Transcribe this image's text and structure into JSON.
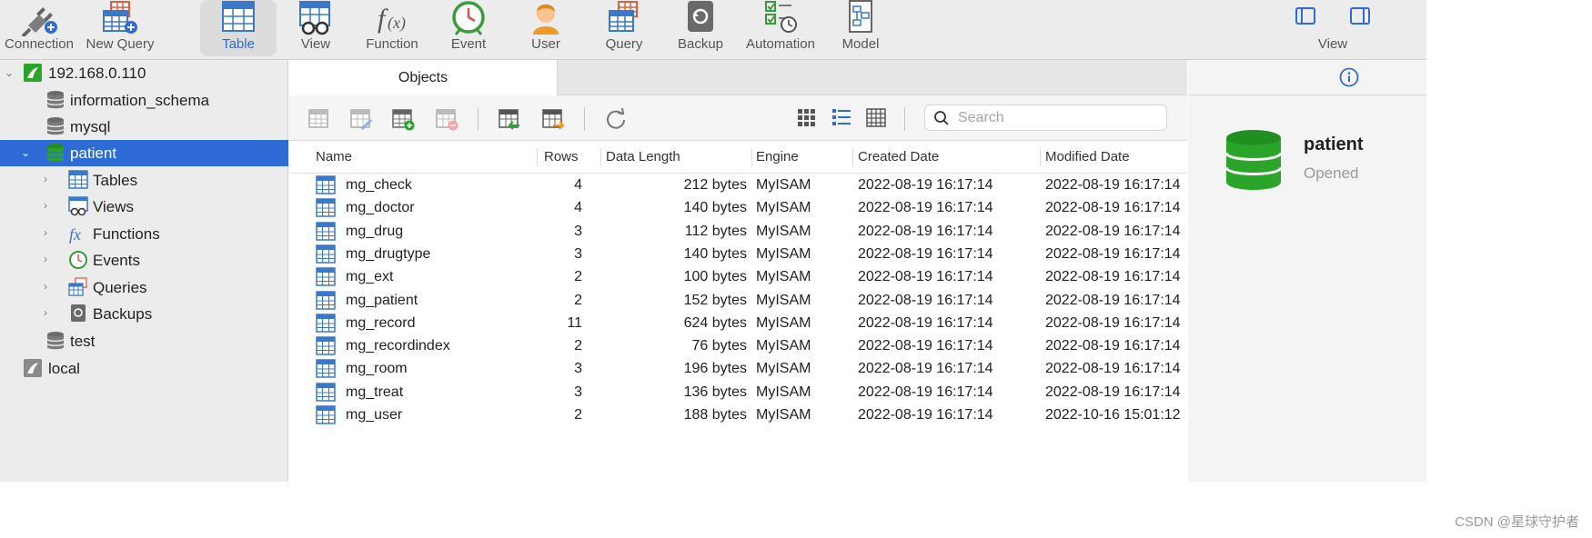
{
  "toolbar": {
    "items": [
      {
        "label": "Connection",
        "icon": "connection-plug-icon"
      },
      {
        "label": "New Query",
        "icon": "new-query-icon"
      },
      {
        "label": "Table",
        "icon": "table-icon",
        "active": true
      },
      {
        "label": "View",
        "icon": "view-glasses-icon"
      },
      {
        "label": "Function",
        "icon": "function-fx-icon"
      },
      {
        "label": "Event",
        "icon": "event-clock-icon"
      },
      {
        "label": "User",
        "icon": "user-icon"
      },
      {
        "label": "Query",
        "icon": "query-icon"
      },
      {
        "label": "Backup",
        "icon": "backup-icon"
      },
      {
        "label": "Automation",
        "icon": "automation-icon"
      },
      {
        "label": "Model",
        "icon": "model-icon"
      }
    ],
    "view_label": "View"
  },
  "sidebar": {
    "connection": "192.168.0.110",
    "databases": [
      "information_schema",
      "mysql",
      "patient"
    ],
    "selected_db": "patient",
    "children": [
      "Tables",
      "Views",
      "Functions",
      "Events",
      "Queries",
      "Backups"
    ],
    "other_db": "test",
    "local": "local"
  },
  "main": {
    "tab": "Objects",
    "search_placeholder": "Search",
    "columns": [
      "Name",
      "Rows",
      "Data Length",
      "Engine",
      "Created Date",
      "Modified Date"
    ],
    "rows": [
      {
        "name": "mg_check",
        "rows": "4",
        "length": "212 bytes",
        "engine": "MyISAM",
        "created": "2022-08-19 16:17:14",
        "modified": "2022-08-19 16:17:14"
      },
      {
        "name": "mg_doctor",
        "rows": "4",
        "length": "140 bytes",
        "engine": "MyISAM",
        "created": "2022-08-19 16:17:14",
        "modified": "2022-08-19 16:17:14"
      },
      {
        "name": "mg_drug",
        "rows": "3",
        "length": "112 bytes",
        "engine": "MyISAM",
        "created": "2022-08-19 16:17:14",
        "modified": "2022-08-19 16:17:14"
      },
      {
        "name": "mg_drugtype",
        "rows": "3",
        "length": "140 bytes",
        "engine": "MyISAM",
        "created": "2022-08-19 16:17:14",
        "modified": "2022-08-19 16:17:14"
      },
      {
        "name": "mg_ext",
        "rows": "2",
        "length": "100 bytes",
        "engine": "MyISAM",
        "created": "2022-08-19 16:17:14",
        "modified": "2022-08-19 16:17:14"
      },
      {
        "name": "mg_patient",
        "rows": "2",
        "length": "152 bytes",
        "engine": "MyISAM",
        "created": "2022-08-19 16:17:14",
        "modified": "2022-08-19 16:17:14"
      },
      {
        "name": "mg_record",
        "rows": "11",
        "length": "624 bytes",
        "engine": "MyISAM",
        "created": "2022-08-19 16:17:14",
        "modified": "2022-08-19 16:17:14"
      },
      {
        "name": "mg_recordindex",
        "rows": "2",
        "length": "76 bytes",
        "engine": "MyISAM",
        "created": "2022-08-19 16:17:14",
        "modified": "2022-08-19 16:17:14"
      },
      {
        "name": "mg_room",
        "rows": "3",
        "length": "196 bytes",
        "engine": "MyISAM",
        "created": "2022-08-19 16:17:14",
        "modified": "2022-08-19 16:17:14"
      },
      {
        "name": "mg_treat",
        "rows": "3",
        "length": "136 bytes",
        "engine": "MyISAM",
        "created": "2022-08-19 16:17:14",
        "modified": "2022-08-19 16:17:14"
      },
      {
        "name": "mg_user",
        "rows": "2",
        "length": "188 bytes",
        "engine": "MyISAM",
        "created": "2022-08-19 16:17:14",
        "modified": "2022-10-16 15:01:12"
      }
    ]
  },
  "info": {
    "db_name": "patient",
    "status": "Opened"
  },
  "watermark": "CSDN @星球守护者",
  "colors": {
    "accent": "#2f6bd6",
    "db_green": "#2aa52a",
    "table_blue": "#3a78c9"
  }
}
